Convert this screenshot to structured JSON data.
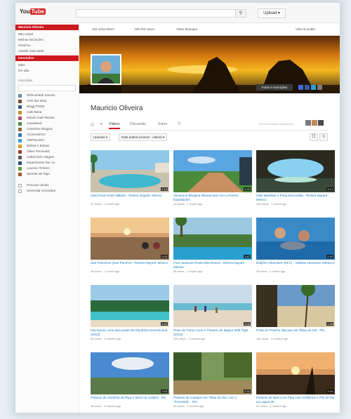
{
  "topbar": {
    "logo_you": "You",
    "logo_tube": "Tube",
    "search_button": "⚲",
    "upload_label": "Upload ▾"
  },
  "sidebar": {
    "active_head": "Mauricio Oliveira",
    "items_top": [
      "Meu canal",
      "Minhas inscrições",
      "Histórico",
      "Assistir mais tarde"
    ],
    "section_head": "Inscrições",
    "items_mid": [
      "Mais",
      "Em alta"
    ],
    "subs_title": "Inscrições",
    "subs": [
      "#Ethnohardi Sonora",
      "Amé taxi taisa",
      "Blogg PODE",
      "Cafe Baria",
      "Mundo mais Noivas",
      "Junaisland",
      "Caixinhos Blogpra",
      "AccensnEVO",
      "TMPOLOGA",
      "Bolhas e Bolsas",
      "Video Personals",
      "Cabal Gem Viagem",
      "Experiments Tav. Ac.",
      "Loureiro Tinform",
      "Sprinter de Tags"
    ],
    "footer_items": [
      "Procurar canais",
      "Gerenciar inscrições"
    ]
  },
  "stats": {
    "subscribers": "184 subscribers",
    "views": "199,783 views",
    "video_manager": "Video Manager",
    "view_as_public": "View as public"
  },
  "banner": {
    "subscribe_link": "Fotos e Inscrições"
  },
  "channel": {
    "title": "Mauricio Oliveira",
    "tabs": [
      "Vídeos",
      "Discussão",
      "Sobre"
    ],
    "suggestion": "Fiz Lot no tutus subscribers",
    "filter_uploads": "Uploads ▾",
    "filter_date": "Date added (newest - oldest) ▾",
    "grid_view": "☷",
    "list_view": "≡"
  },
  "videos": [
    {
      "title": "Hard Rock Hotel Vallarta - Riviera Nayarit, México",
      "meta": "20 views · 1 month ago",
      "duration": "2:18"
    },
    {
      "title": "Alimentos Bhujana Islands and com a Pereiro Expedições",
      "meta": "12 views · 1 month ago",
      "duration": "4:20"
    },
    {
      "title": "Islas Marietas e Praia Escondida - Riviera Nayarit - México",
      "meta": "256 views · 1 month ago",
      "duration": "3:14"
    },
    {
      "title": "San Francisco (San Pancho) - Riviera Nayarit, México",
      "meta": "46 views · 1 month ago",
      "duration": "2:03"
    },
    {
      "title": "Four Seasons Punta Mita Resort - Riviera Nayarit - México",
      "meta": "36 views · 1 month ago",
      "duration": "2:47"
    },
    {
      "title": "Dolphin Adventure (DFC) - Vallarta Adventure (México)",
      "meta": "28 views · 1 month ago",
      "duration": "2:32"
    },
    {
      "title": "Isla Saona, uma das praias da República Dominicana (2013)",
      "meta": "88 views · 2 months ago",
      "duration": "1:52"
    },
    {
      "title": "Praia de Ponta Cana e Passeio de Bagna Wild Tiger (2013)",
      "meta": "230 views · 2 months ago",
      "duration": "3:06"
    },
    {
      "title": "Praia do Piranha Ilag aao em Tibau do Sol - RN",
      "meta": "118 views · 3 months ago",
      "duration": "1:28"
    },
    {
      "title": "Passeio de Jardinha de Pipa e forno na Caldeir - RN",
      "meta": "36 views · 3 months ago",
      "duration": "2:33"
    },
    {
      "title": "Passeio de Caiaque em Tibau do Sol, com o \"Fernanda\" - RN",
      "meta": "53 views · 3 months ago",
      "duration": "2:31"
    },
    {
      "title": "Passeio de Barco em Pipa com Golfinhos e Pôr do Sol na Lagoa de...",
      "meta": "92 views · 3 months ago",
      "duration": "2:16"
    }
  ],
  "colors": {
    "accent_red": "#cc181e",
    "link_blue": "#167ac6"
  }
}
